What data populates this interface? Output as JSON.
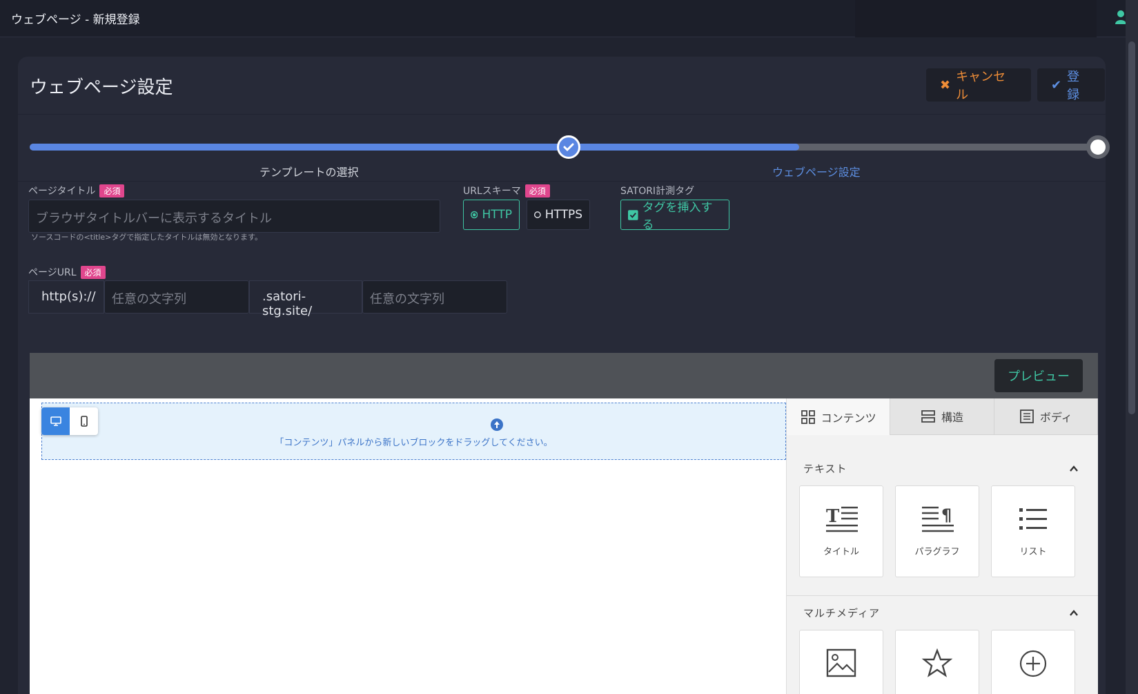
{
  "window": {
    "title": "ウェブページ - 新規登録"
  },
  "header": {
    "title": "ウェブページ設定",
    "cancel_label": "キャンセル",
    "save_label": "登録"
  },
  "progress": {
    "percent_complete": 72,
    "steps": [
      {
        "label": "テンプレートの選択",
        "status": "done"
      },
      {
        "label": "ウェブページ設定",
        "status": "current"
      }
    ]
  },
  "form": {
    "page_title": {
      "label": "ページタイトル",
      "required": "必須",
      "placeholder": "ブラウザタイトルバーに表示するタイトル",
      "hint": "ソースコードの<title>タグで指定したタイトルは無効となります。"
    },
    "url_scheme": {
      "label": "URLスキーマ",
      "required": "必須",
      "options": [
        "HTTP",
        "HTTPS"
      ],
      "selected": "HTTP"
    },
    "satori_tag": {
      "label": "SATORI計測タグ",
      "option": "タグを挿入する",
      "checked": true
    },
    "page_url": {
      "label": "ページURL",
      "required": "必須",
      "prefix": "http(s)://",
      "subdomain_placeholder": "任意の文字列",
      "domain": ".satori-stg.site/",
      "path_placeholder": "任意の文字列"
    }
  },
  "editor": {
    "preview_label": "プレビュー",
    "dropzone_message": "「コンテンツ」パネルから新しいブロックをドラッグしてください。",
    "device_modes": [
      "desktop",
      "mobile"
    ],
    "active_device": "desktop"
  },
  "panel": {
    "tabs": [
      {
        "label": "コンテンツ",
        "icon": "grid-icon"
      },
      {
        "label": "構造",
        "icon": "structure-icon"
      },
      {
        "label": "ボディ",
        "icon": "document-icon"
      }
    ],
    "active_tab": "コンテンツ",
    "sections": [
      {
        "title": "テキスト",
        "blocks": [
          {
            "label": "タイトル",
            "icon": "title-icon"
          },
          {
            "label": "パラグラフ",
            "icon": "paragraph-icon"
          },
          {
            "label": "リスト",
            "icon": "list-icon"
          }
        ]
      },
      {
        "title": "マルチメディア",
        "blocks": [
          {
            "label": "",
            "icon": "image-icon"
          },
          {
            "label": "",
            "icon": "star-icon"
          },
          {
            "label": "",
            "icon": "plus-circle-icon"
          }
        ]
      }
    ]
  },
  "colors": {
    "accent_blue": "#5a86e2",
    "accent_teal": "#3fc7a4",
    "cancel_orange": "#ef8d37",
    "required_pink": "#e0468d"
  }
}
